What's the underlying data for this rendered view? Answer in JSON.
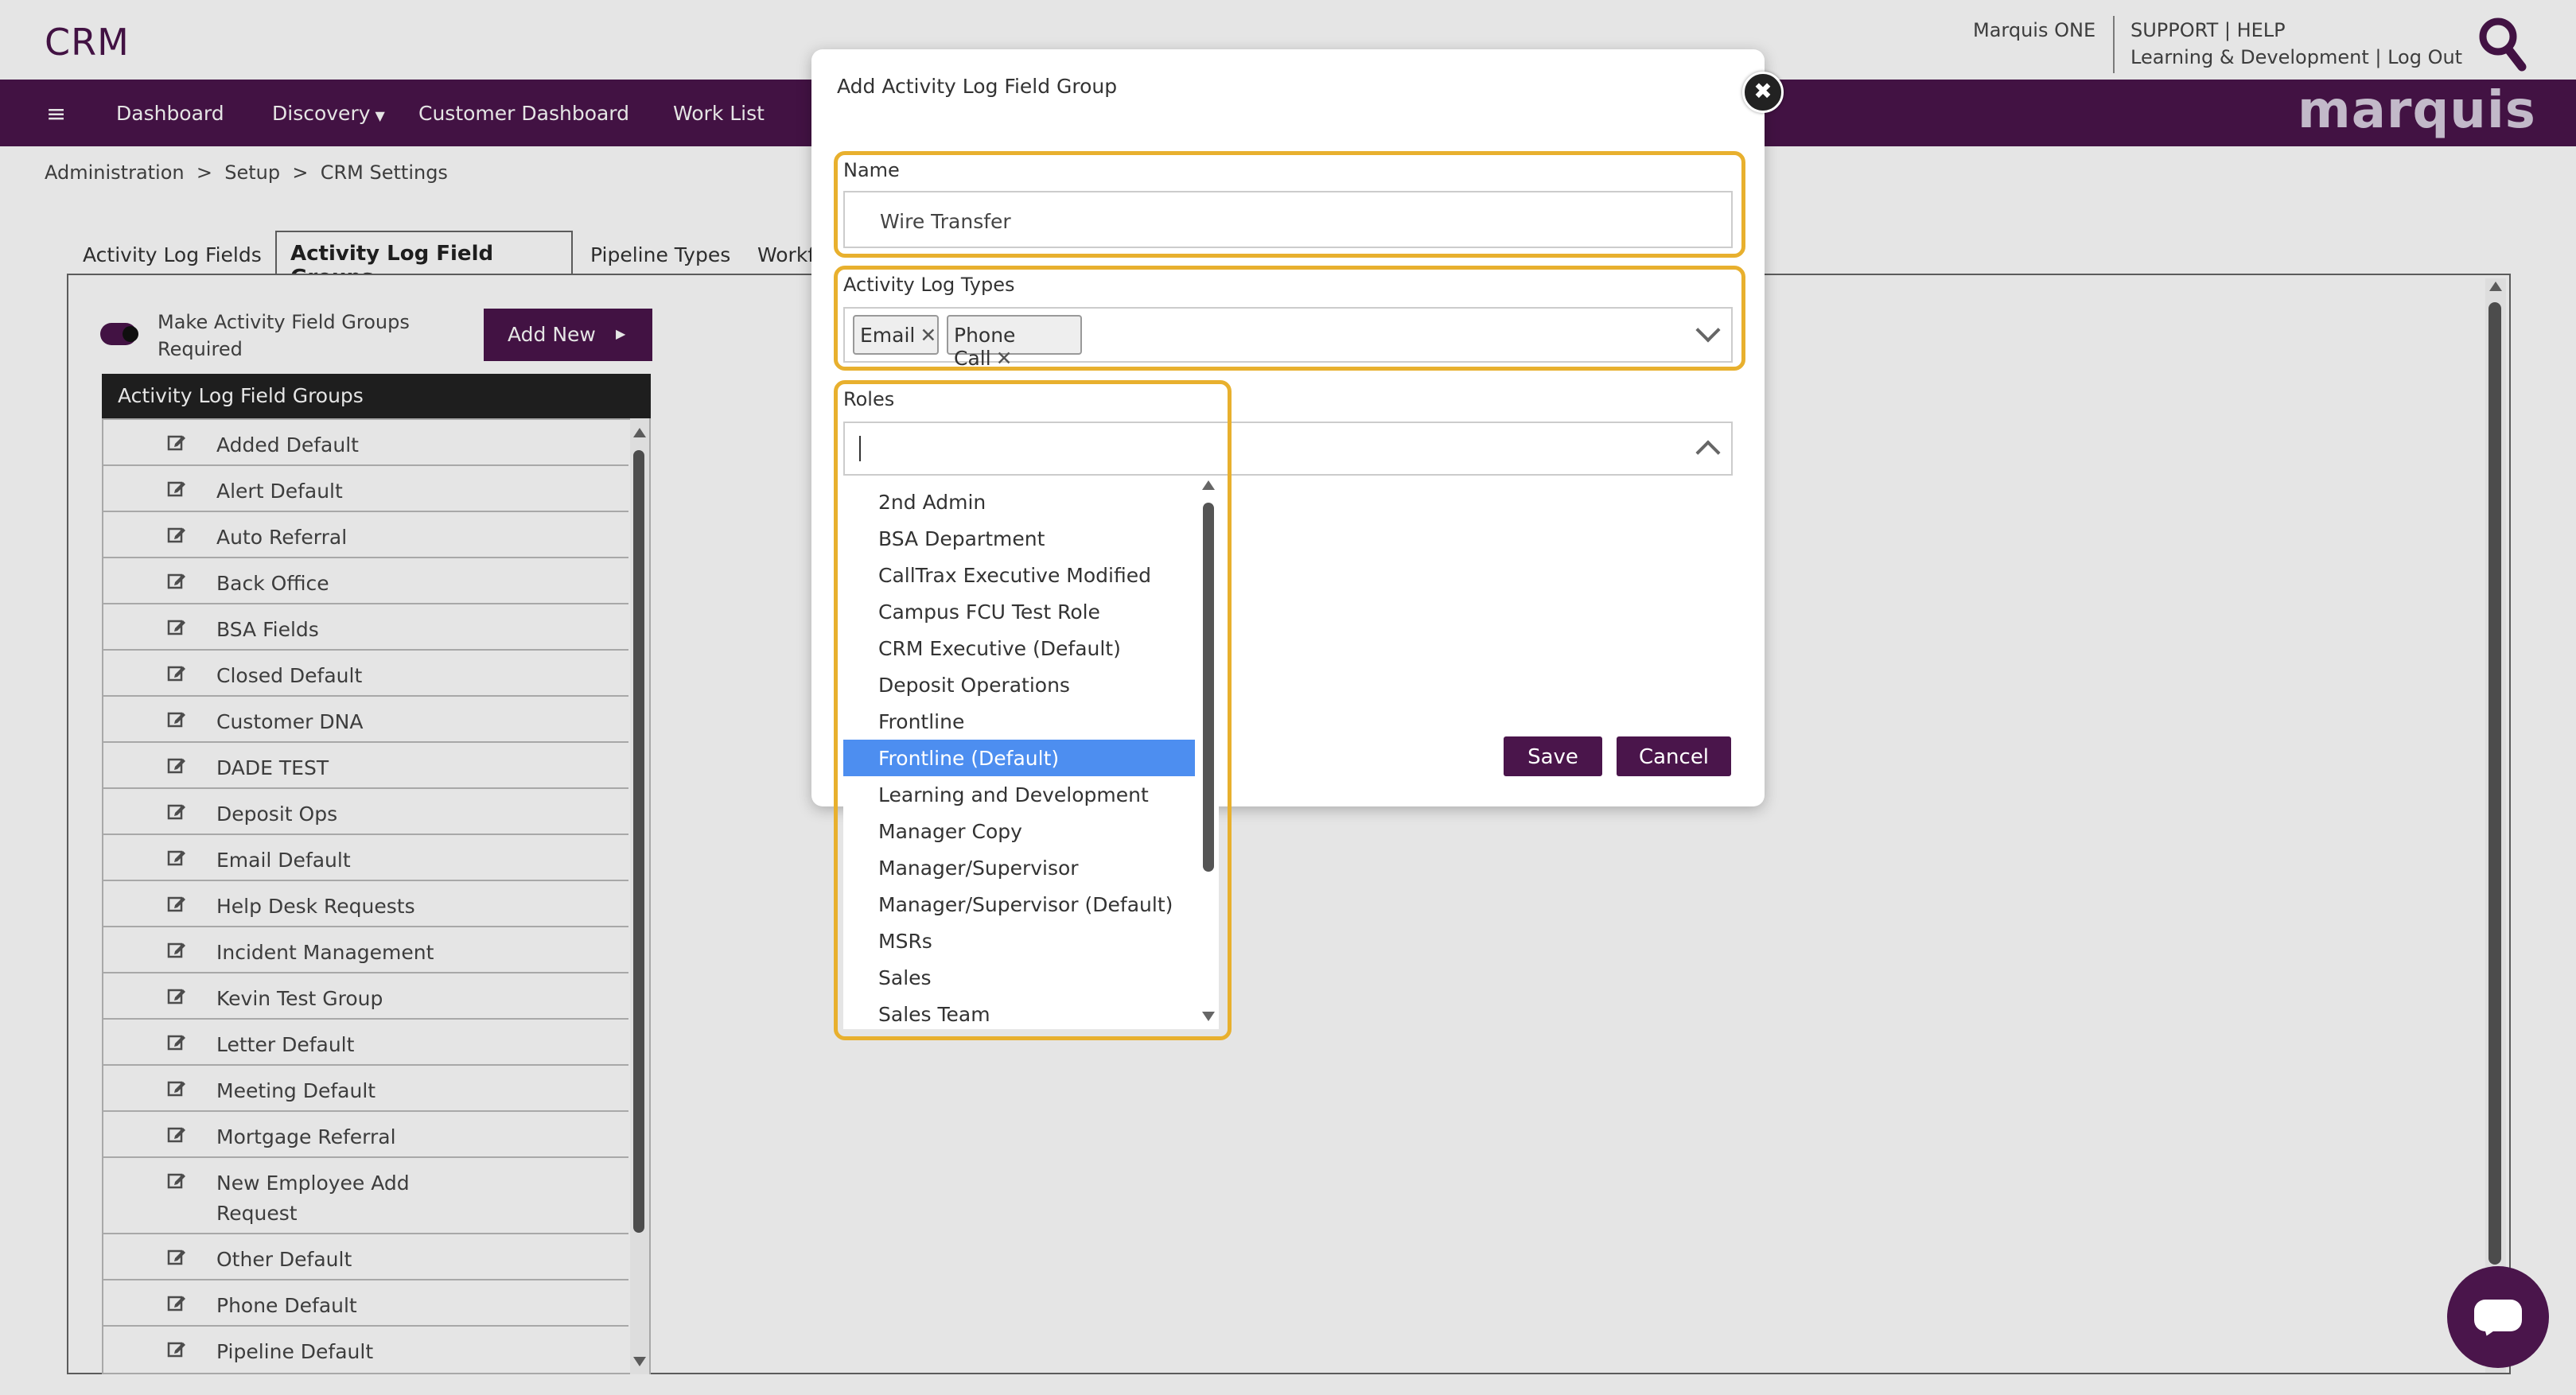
{
  "header": {
    "app_title": "CRM",
    "user_label": "Marquis ONE",
    "links_line1": "SUPPORT | HELP",
    "links_line2": "Learning & Development | Log Out",
    "brand": "marquis"
  },
  "nav": {
    "items": [
      "Dashboard",
      "Discovery",
      "Customer Dashboard",
      "Work List"
    ]
  },
  "breadcrumb": "Administration  >  Setup  >  CRM Settings",
  "tabs": [
    "Activity Log Fields",
    "Activity Log Field Groups",
    "Pipeline Types",
    "Workf"
  ],
  "toolbar": {
    "toggle_label": "Make Activity Field Groups Required",
    "add_new_label": "Add New"
  },
  "field_groups": {
    "header": "Activity Log Field Groups",
    "items": [
      "Added Default",
      "Alert Default",
      "Auto Referral",
      "Back Office",
      "BSA Fields",
      "Closed Default",
      "Customer DNA",
      "DADE TEST",
      "Deposit Ops",
      "Email Default",
      "Help Desk Requests",
      "Incident Management",
      "Kevin Test Group",
      "Letter Default",
      "Meeting Default",
      "Mortgage Referral",
      "New Employee Add Request",
      "Other Default",
      "Phone Default",
      "Pipeline Default"
    ]
  },
  "modal": {
    "title": "Add Activity Log Field Group",
    "name_label": "Name",
    "name_value": "Wire Transfer",
    "types_label": "Activity Log Types",
    "types_tags": [
      "Email",
      "Phone Call"
    ],
    "roles_label": "Roles",
    "roles_options": [
      "2nd Admin",
      "BSA Department",
      "CallTrax Executive Modified",
      "Campus FCU Test Role",
      "CRM Executive (Default)",
      "Deposit Operations",
      "Frontline",
      "Frontline (Default)",
      "Learning and Development",
      "Manager Copy",
      "Manager/Supervisor",
      "Manager/Supervisor (Default)",
      "MSRs",
      "Sales",
      "Sales Team"
    ],
    "roles_selected": "Frontline (Default)",
    "save_label": "Save",
    "cancel_label": "Cancel",
    "close_glyph": "✖"
  },
  "colors": {
    "brand_purple": "#4a154b",
    "highlight_orange": "#e8b02e",
    "selected_blue": "#4d8ef0"
  }
}
